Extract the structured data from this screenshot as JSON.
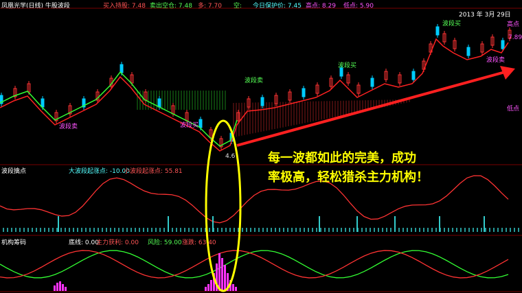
{
  "main_header": {
    "title": "凤凰光学(日线) 牛股波段",
    "buy_hold_label": "买入持股: 7.48",
    "sell_empty_label": "卖出空仓: 7.48",
    "duo_label": "多: 7.70",
    "kong_label": "空:",
    "protect_label": "今日保护价: 7.45",
    "high_label": "高点: 8.29",
    "low_label": "低点: 5.90"
  },
  "main_chart": {
    "date_label": "2013 年 3月 29日",
    "price_label": "7.89",
    "high_tag": "高点",
    "low_tag": "低点",
    "low_price": "4.6",
    "annotations": [
      "波段卖",
      "波段买",
      "波段卖",
      "波段买",
      "波段买",
      "波段卖"
    ]
  },
  "callout": {
    "line1": "每一波都如此的完美，成功",
    "line2": "率极高，轻松猎杀主力机构！"
  },
  "pane2_header": {
    "title": "波段擒点",
    "big_wave_label": "大波段起涨点: -10.00",
    "small_wave_label": "小波段起涨点: 55.81"
  },
  "pane3_header": {
    "title": "机构筹码",
    "bottom_line_label": "底线: 0.00",
    "main_profit_label": "主力获利: 0.00",
    "risk_label": "风险: 59.00",
    "up_label": "涨跌: 63.40"
  },
  "colors": {
    "up_candle": "#ff3333",
    "down_candle": "#00ccff",
    "ma_line": "#ff2222",
    "green_line": "#33ff33",
    "header_text": "#ffffff",
    "callout_text": "#ffff00",
    "arrow": "#ff2020",
    "ellipse": "#ffff00",
    "magenta": "#ff33ff",
    "cyan_ticks": "#33cccc"
  }
}
